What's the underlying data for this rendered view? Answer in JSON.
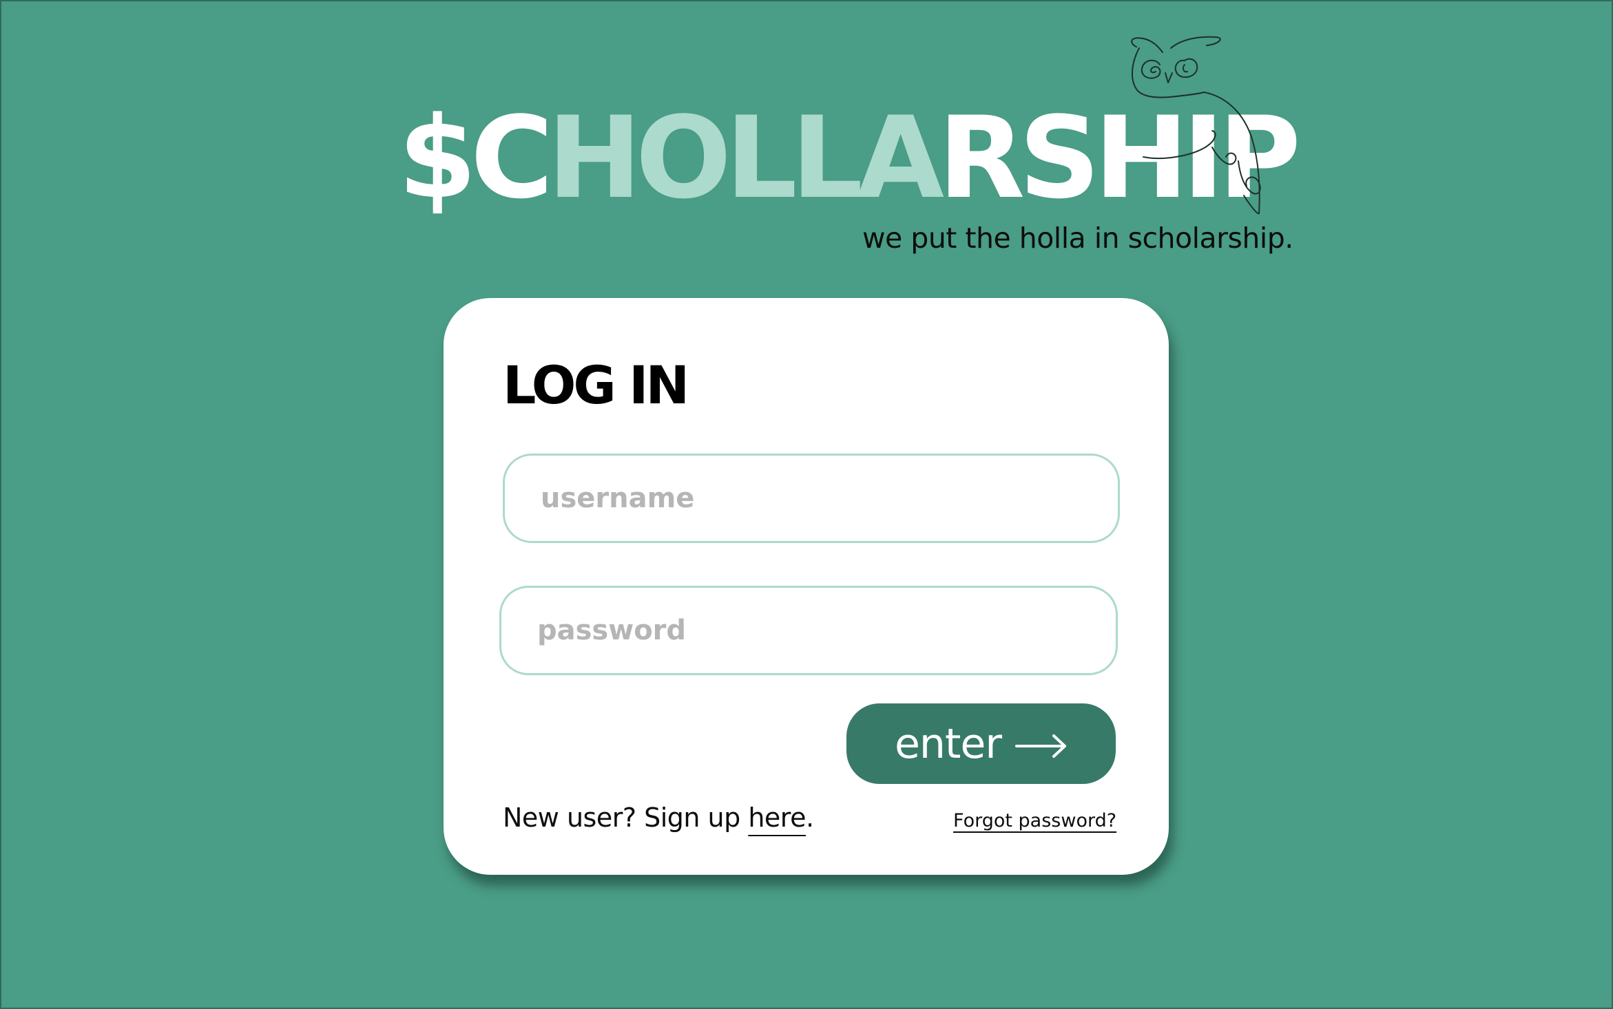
{
  "brand": {
    "logo_parts": [
      "$C",
      "HOLLA",
      "RSHIP"
    ],
    "tagline": "we put the holla in scholarship."
  },
  "login": {
    "title": "LOG IN",
    "username_placeholder": "username",
    "password_placeholder": "password",
    "enter_label": "enter",
    "signup_prefix": "New user? Sign up ",
    "signup_link": "here",
    "signup_suffix": ".",
    "forgot_password": "Forgot password?"
  },
  "icons": {
    "brand_mascot": "owl-line-drawing-icon",
    "submit_arrow": "arrow-right-icon"
  },
  "colors": {
    "background": "#4a9d86",
    "logo_white": "#ffffff",
    "logo_mint": "#acdacd",
    "field_border": "#acdacd",
    "button": "#377a68",
    "placeholder": "#b5b5b5",
    "text": "#0d0d0d"
  }
}
